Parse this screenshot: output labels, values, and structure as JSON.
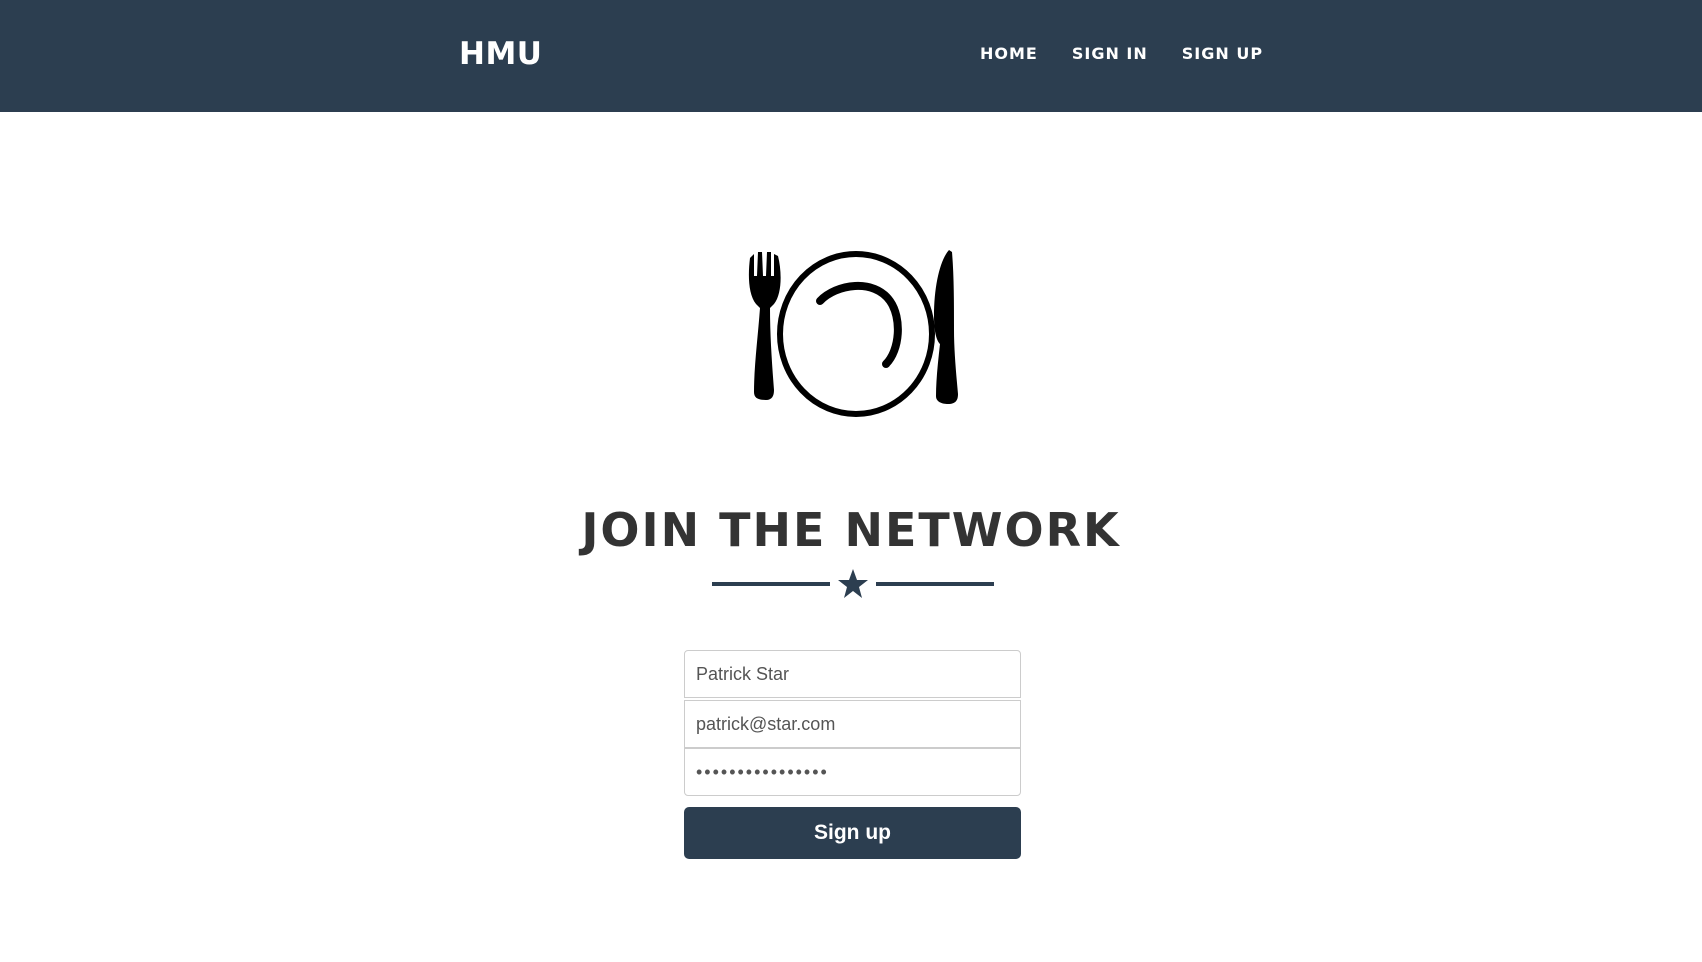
{
  "navbar": {
    "brand": "HMU",
    "links": [
      "HOME",
      "SIGN IN",
      "SIGN UP"
    ],
    "background": "#2c3e50"
  },
  "logo": {
    "icon": "plate-fork-knife-icon"
  },
  "main": {
    "heading": "JOIN THE NETWORK",
    "divider_icon": "star-icon"
  },
  "form": {
    "name_value": "Patrick Star",
    "email_value": "patrick@star.com",
    "password_value": "••••••••••••••••",
    "submit_label": "Sign up"
  },
  "colors": {
    "primary": "#2c3e50",
    "heading_text": "#333333"
  }
}
